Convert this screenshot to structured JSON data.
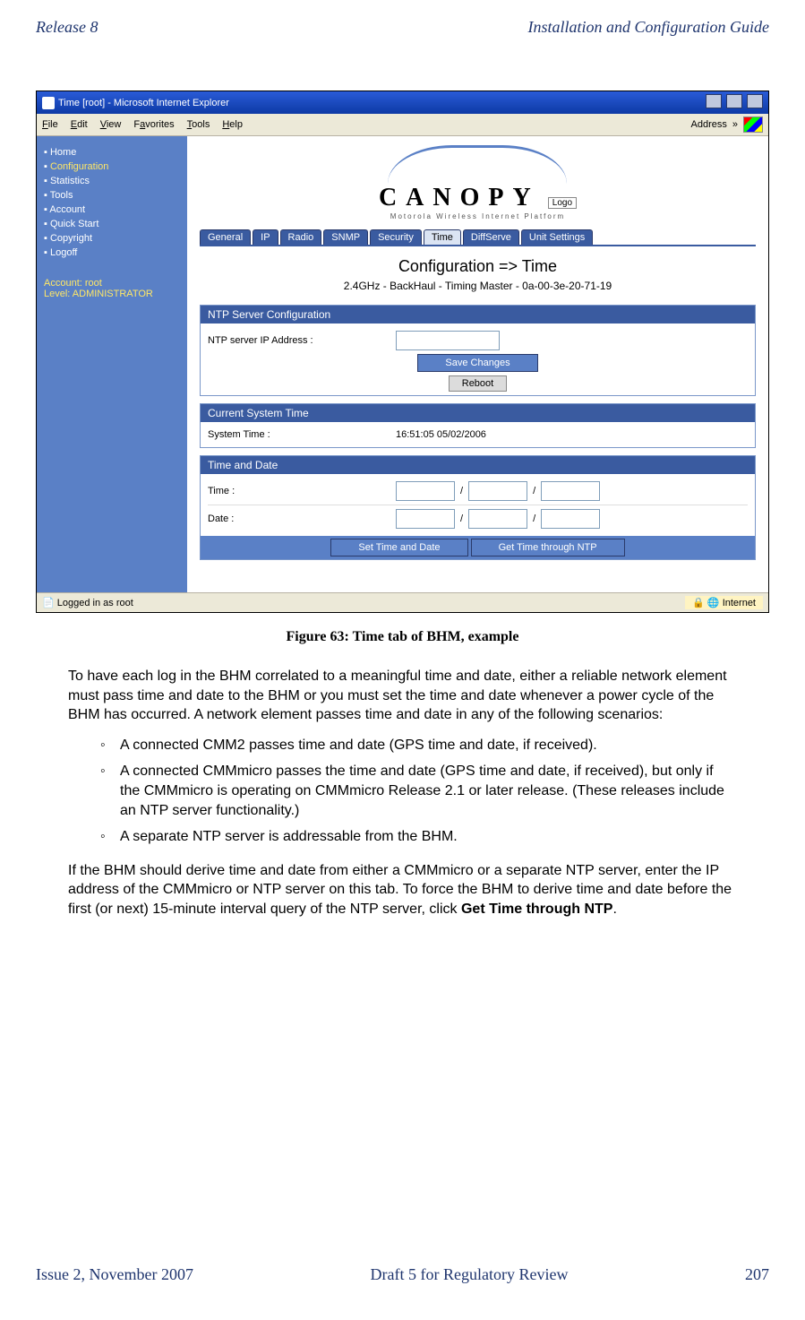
{
  "header": {
    "left": "Release 8",
    "right": "Installation and Configuration Guide"
  },
  "footer": {
    "left": "Issue 2, November 2007",
    "center": "Draft 5 for Regulatory Review",
    "right": "207"
  },
  "caption": "Figure 63: Time tab of BHM, example",
  "browser": {
    "title": "Time [root] - Microsoft Internet Explorer",
    "menus": [
      "File",
      "Edit",
      "View",
      "Favorites",
      "Tools",
      "Help"
    ],
    "address_label": "Address",
    "status_left": "Logged in as root",
    "status_zone": "Internet"
  },
  "logo": {
    "wordmark": "CANOPY",
    "tagline": "Motorola Wireless Internet Platform",
    "box": "Logo"
  },
  "sidebar": {
    "items": [
      "Home",
      "Configuration",
      "Statistics",
      "Tools",
      "Account",
      "Quick Start",
      "Copyright",
      "Logoff"
    ],
    "active_index": 1,
    "account_line1": "Account: root",
    "account_line2": "Level: ADMINISTRATOR"
  },
  "tabs": {
    "items": [
      "General",
      "IP",
      "Radio",
      "SNMP",
      "Security",
      "Time",
      "DiffServe",
      "Unit Settings"
    ],
    "active_index": 5
  },
  "page": {
    "title": "Configuration => Time",
    "subtitle": "2.4GHz - BackHaul - Timing Master - 0a-00-3e-20-71-19"
  },
  "panels": {
    "ntp": {
      "title": "NTP Server Configuration",
      "label": "NTP server IP Address :",
      "save": "Save Changes",
      "reboot": "Reboot"
    },
    "current": {
      "title": "Current System Time",
      "label": "System Time :",
      "value": "16:51:05 05/02/2006"
    },
    "timedate": {
      "title": "Time and Date",
      "time_label": "Time :",
      "date_label": "Date :",
      "set_btn": "Set Time and Date",
      "get_btn": "Get Time through NTP"
    }
  },
  "body": {
    "p1": "To have each log in the BHM correlated to a meaningful time and date, either a reliable network element must pass time and date to the BHM or you must set the time and date whenever a power cycle of the BHM has occurred. A network element passes time and date in any of the following scenarios:",
    "b1": "A connected CMM2 passes time and date (GPS time and date, if received).",
    "b2": "A connected CMMmicro passes the time and date (GPS time and date, if received), but only if the CMMmicro is operating on CMMmicro Release 2.1 or later release. (These releases include an NTP server functionality.)",
    "b3": "A separate NTP server is addressable from the BHM.",
    "p2a": "If the BHM should derive time and date from either a CMMmicro or a separate NTP server, enter the IP address of the CMMmicro or NTP server on this tab. To force the BHM to derive time and date before the first (or next) 15-minute interval query of the NTP server, click ",
    "p2b": "Get Time through NTP",
    "p2c": "."
  }
}
